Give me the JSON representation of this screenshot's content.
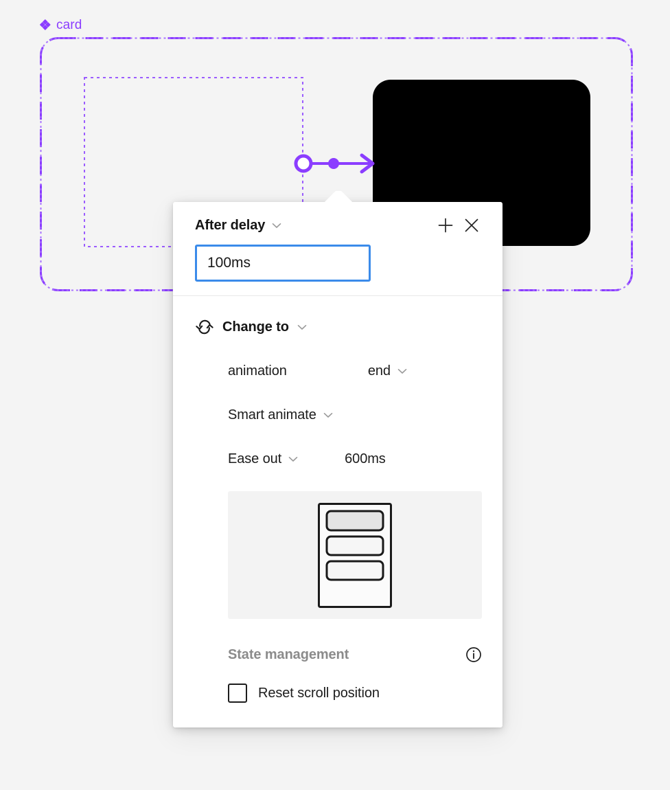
{
  "canvas": {
    "component": {
      "name": "card",
      "icon": "component-diamond-icon",
      "accent_color": "#8b3dff"
    },
    "variant_shape": {
      "name": "black-variant-rect",
      "fill": "#000000"
    },
    "connector": {
      "name": "prototype-connector",
      "color": "#8b3dff"
    }
  },
  "panel": {
    "header": {
      "trigger_label": "After delay",
      "add_label": "+",
      "close_label": "×"
    },
    "delay": {
      "value": "100ms",
      "placeholder": "100ms",
      "focus_color": "#3b8bea"
    },
    "action": {
      "label": "Change to",
      "icon": "swap-arrows-icon",
      "destination_name": "animation",
      "destination_value": "end",
      "animation_type": "Smart animate",
      "easing": "Ease out",
      "duration": "600ms"
    },
    "state_management": {
      "title": "State management",
      "info_icon": "info-circle-icon",
      "reset_scroll_label": "Reset scroll position",
      "reset_scroll_checked": false
    }
  }
}
